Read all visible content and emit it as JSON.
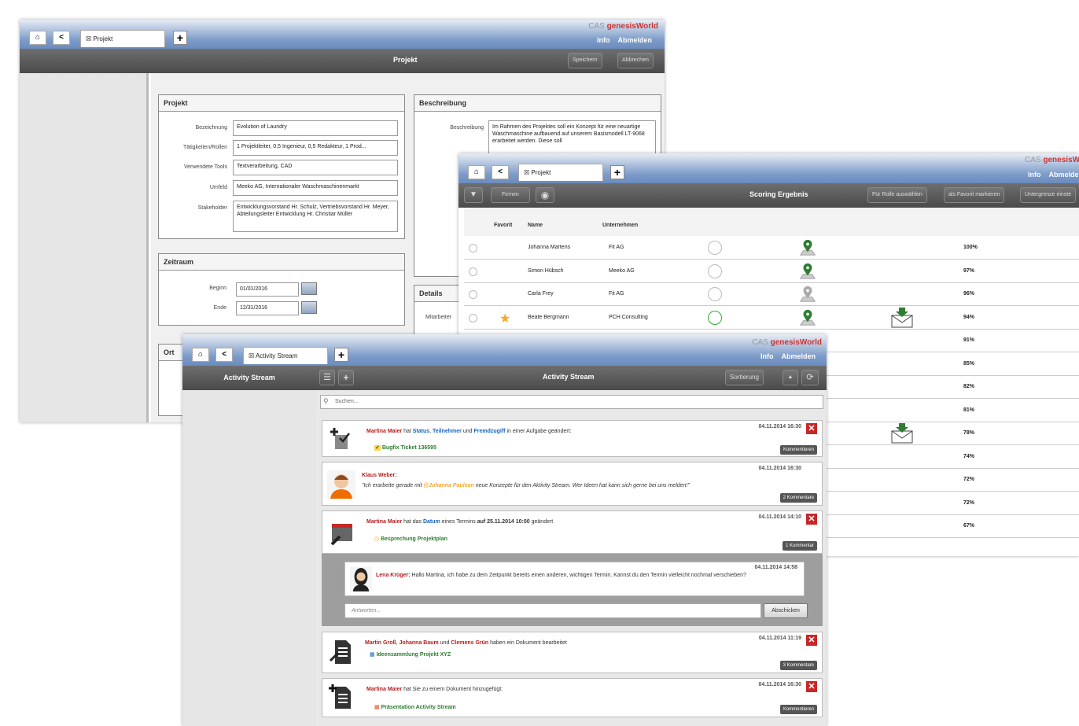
{
  "brand": {
    "cas": "CAS",
    "name": "genesisWorld",
    "info": "Info",
    "logout": "Abmelden"
  },
  "win1": {
    "tab_label": "Projekt",
    "toolbar_title": "Projekt",
    "save": "Speichern",
    "cancel": "Abbrechen",
    "projekt_panel": {
      "title": "Projekt",
      "fields": [
        {
          "label": "Bezeichnung",
          "value": "Evolution of Laundry"
        },
        {
          "label": "Tätigkeiten/Rollen",
          "value": "1 Projektleiter, 0,5 Ingenieur, 0,5 Redakteur, 1 Prod..."
        },
        {
          "label": "Verwendete Tools",
          "value": "Textverarbeitung, CAD"
        },
        {
          "label": "Umfeld",
          "value": "Meeko AG, Internationaler Waschmaschinenmarkt"
        },
        {
          "label": "Stakeholder",
          "value": "Entwicklungsvorstand Hr. Schulz, Vertriebsvorstand Hr. Meyer, Abteilungsleiter Entwicklung Hr. Christiar Müller"
        }
      ]
    },
    "zeitraum_panel": {
      "title": "Zeitraum",
      "begin_label": "Beginn",
      "begin": "01/01/2016",
      "end_label": "Ende",
      "end": "12/31/2016"
    },
    "ort_panel": {
      "title": "Ort"
    },
    "beschreibung_panel": {
      "title": "Beschreibung",
      "label": "Beschreibung",
      "text": "Im Rahmen des Projektes soll ein Konzept für eine neuartige Waschmaschine aufbauend auf unserem Basismodell LT-9068 erarbeitet werden. Diese soll"
    },
    "details_panel": {
      "title": "Details",
      "label": "Mitarbeiter"
    }
  },
  "win2": {
    "tab_label": "Projekt",
    "firms_btn": "Firmen",
    "title": "Scoring Ergebnis",
    "btn_role": "Für Rolle auswählen",
    "btn_fav": "als Favorit markieren",
    "btn_limit": "Untergrenze einste",
    "columns": {
      "favorit": "Favorit",
      "name": "Name",
      "company": "Unternehmen"
    },
    "rows": [
      {
        "name": "Johanna Martens",
        "company": "Fit AG",
        "score": "100%",
        "fav": false,
        "pin": "green",
        "clock": "grey",
        "mail": false
      },
      {
        "name": "Simon Hübsch",
        "company": "Meeko AG",
        "score": "97%",
        "fav": false,
        "pin": "green",
        "clock": "grey",
        "mail": false
      },
      {
        "name": "Carla Frey",
        "company": "Fit AG",
        "score": "96%",
        "fav": false,
        "pin": "grey",
        "clock": "grey",
        "mail": false
      },
      {
        "name": "Beate Bergmann",
        "company": "PCH Consulting",
        "score": "94%",
        "fav": true,
        "pin": "green",
        "clock": "green",
        "mail": true
      },
      {
        "name": "",
        "company": "",
        "score": "91%",
        "fav": false,
        "pin": "",
        "clock": "",
        "mail": false
      },
      {
        "name": "",
        "company": "",
        "score": "85%",
        "fav": false,
        "pin": "",
        "clock": "",
        "mail": false
      },
      {
        "name": "",
        "company": "",
        "score": "82%",
        "fav": false,
        "pin": "",
        "clock": "",
        "mail": false
      },
      {
        "name": "",
        "company": "",
        "score": "81%",
        "fav": false,
        "pin": "",
        "clock": "",
        "mail": false
      },
      {
        "name": "",
        "company": "",
        "score": "78%",
        "fav": false,
        "pin": "",
        "clock": "",
        "mail": true
      },
      {
        "name": "",
        "company": "",
        "score": "74%",
        "fav": false,
        "pin": "",
        "clock": "",
        "mail": false
      },
      {
        "name": "",
        "company": "",
        "score": "72%",
        "fav": false,
        "pin": "",
        "clock": "",
        "mail": false
      },
      {
        "name": "",
        "company": "",
        "score": "72%",
        "fav": false,
        "pin": "",
        "clock": "",
        "mail": false
      },
      {
        "name": "",
        "company": "",
        "score": "67%",
        "fav": false,
        "pin": "",
        "clock": "",
        "mail": false
      }
    ]
  },
  "win3": {
    "tab_label": "Activity Stream",
    "sidebar_title": "Activity Stream",
    "title": "Activity Stream",
    "sort": "Sortierung",
    "search_placeholder": "Suchen...",
    "items": [
      {
        "ts": "04.11.2014 16:30",
        "actor": "Martina Maier",
        "t1": " hat ",
        "f1": "Status",
        "t2": ", ",
        "f2": "Teilnehmer",
        "t3": " und ",
        "f3": "Fremdzugiff",
        "t4": " in einer Aufgabe geändert:",
        "link": "Bugfix Ticket 136595",
        "comments": "Kommentieren"
      },
      {
        "ts": "04.11.2014 16:30",
        "actor": "Klaus Weber:",
        "quote_a": "\"Ich erarbeite gerade mit ",
        "mention": "@Johanna Paulsen",
        "quote_b": " neue Konzepte für den Aktivity Stream. Wer Ideen hat kann sich gerne bei uns melden!\"",
        "comments": "2 Kommentare"
      },
      {
        "ts": "04.11.2014 14:10",
        "actor": "Martina Maier",
        "t1": " hat das ",
        "f1": "Datum",
        "t2": " eines Termins ",
        "f2": "auf 25.11.2014 10:00",
        "t3": " geändert",
        "link": "Besprechung Projektplan",
        "comments": "1 Kommentar"
      },
      {
        "ts": "04.11.2014 14:58",
        "actor": "Lena Krüger:",
        "text": " Hallo Martina, ich habe zu dem Zeitpunkt bereits einen anderen, wichtigen Termin. Kannst du den Termin vielleicht nochmal verschieben?",
        "reply_placeholder": "Antworten...",
        "send": "Abschicken"
      },
      {
        "ts": "04.11.2014 11:19",
        "a1": "Martin Groß",
        "s1": ", ",
        "a2": "Johanna Baum",
        "s2": " und ",
        "a3": "Clemens Grün",
        "t": " haben ein Dokument bearbeitet",
        "link": "Ideensammlung Projekt XYZ",
        "comments": "3 Kommentare"
      },
      {
        "ts": "04.11.2014 16:30",
        "actor": "Martina Maier",
        "t": " hat Sie zu einem Dokument hinzugefügt:",
        "link": "Präsentation Activity Stream",
        "comments": "Kommentieren"
      }
    ]
  }
}
